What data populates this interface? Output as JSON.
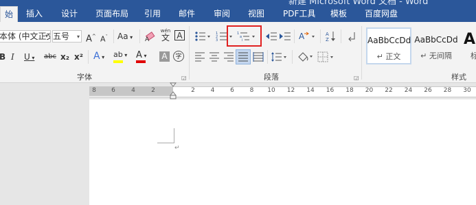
{
  "window": {
    "title": "新建 Microsoft Word 文档 - Word"
  },
  "tabs": [
    "始",
    "插入",
    "设计",
    "页面布局",
    "引用",
    "邮件",
    "审阅",
    "视图",
    "PDF工具",
    "模板",
    "百度网盘"
  ],
  "font_group": {
    "font_name": "本体 (中文正文",
    "font_size": "五号",
    "grow_label": "A",
    "shrink_label": "A",
    "case_label": "Aa",
    "phonetic_label": "wén",
    "char_border_label": "A",
    "bold": "B",
    "italic": "I",
    "underline": "U",
    "strike": "abc",
    "subscript": "x₂",
    "superscript": "x²",
    "text_effect": "A",
    "highlight": "ab",
    "font_color": "A",
    "char_shading": "A",
    "enclose": "字",
    "label": "字体"
  },
  "paragraph_group": {
    "label": "段落"
  },
  "styles_group": {
    "label": "样式",
    "styles": [
      {
        "sample": "AaBbCcDd",
        "name": "正文"
      },
      {
        "sample": "AaBbCcDd",
        "name": "无间隔"
      },
      {
        "sample": "AaB",
        "name": "标"
      }
    ]
  },
  "ruler": {
    "left_numbers": [
      "8",
      "6",
      "4",
      "2"
    ],
    "right_numbers": [
      "2",
      "4",
      "6",
      "8",
      "10",
      "12",
      "14",
      "16",
      "18",
      "20",
      "22",
      "24",
      "26",
      "28",
      "30"
    ]
  },
  "document": {
    "paragraph_mark": "↵"
  },
  "colors": {
    "accent": "#2b579a",
    "highlight_box": "#e02020",
    "font_color_bar": "#e00000",
    "highlight_bar": "#ffff00"
  }
}
